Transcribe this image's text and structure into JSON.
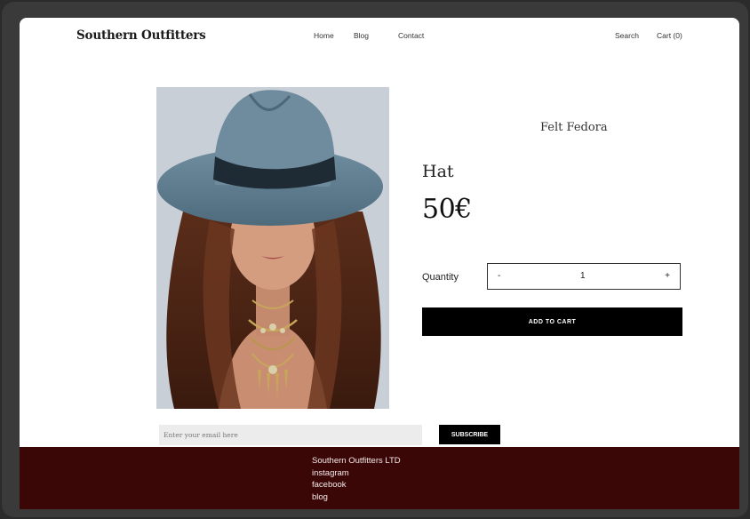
{
  "header": {
    "brand": "Southern Outfitters",
    "nav": [
      "Home",
      "Blog",
      "Contact"
    ],
    "search_label": "Search",
    "cart_label": "Cart (0)"
  },
  "product": {
    "subtitle": "Felt Fedora",
    "title": "Hat",
    "price": "50€",
    "quantity_label": "Quantity",
    "quantity_minus": "-",
    "quantity_value": "1",
    "quantity_plus": "+",
    "add_to_cart_label": "ADD TO CART"
  },
  "newsletter": {
    "email_placeholder": "Enter your email here",
    "subscribe_label": "SUBSCRIBE"
  },
  "footer": {
    "company": "Southern Outfitters LTD",
    "links": [
      "instagram",
      "facebook",
      "blog"
    ]
  },
  "colors": {
    "footer_bg": "#3b0606",
    "button_bg": "#000000",
    "input_bg": "#ececec"
  },
  "icons": {
    "product_photo": "woman-in-fedora-photo"
  }
}
